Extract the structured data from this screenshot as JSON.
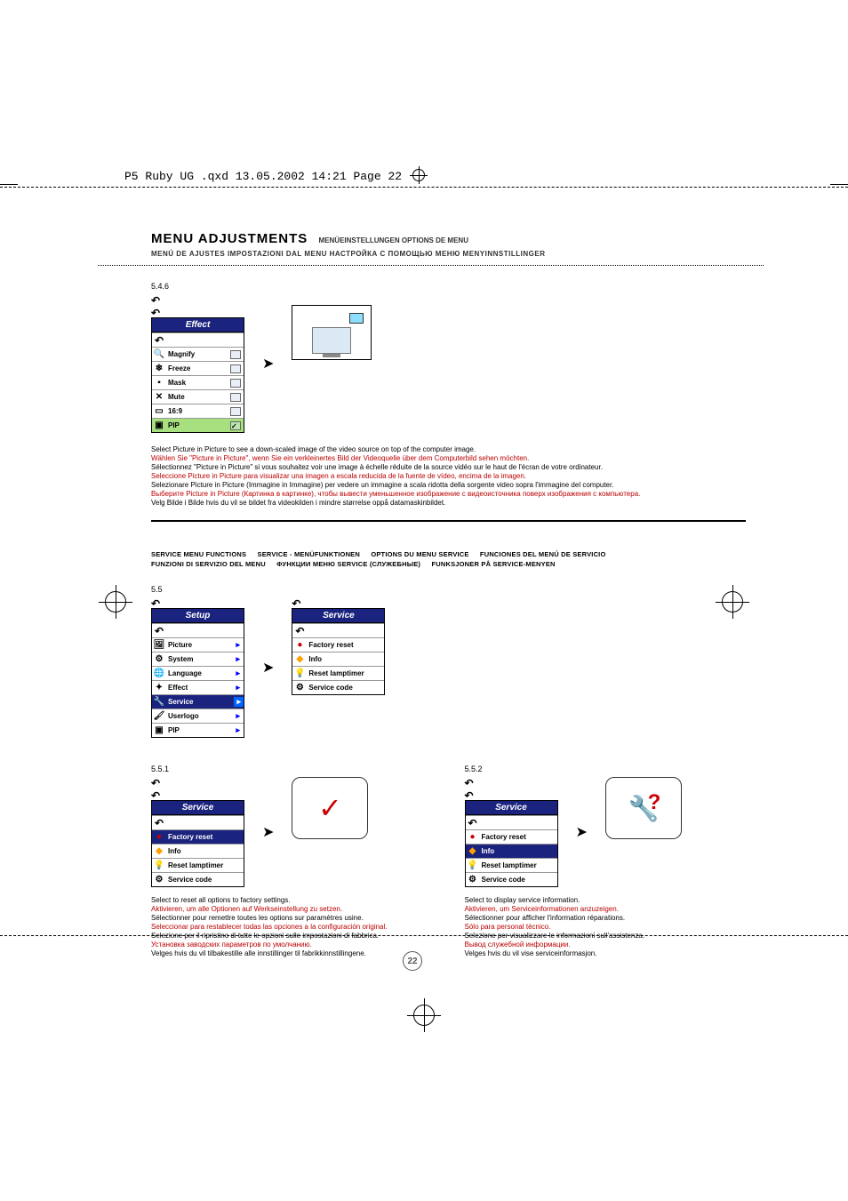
{
  "imposition_header": "P5 Ruby UG .qxd  13.05.2002  14:21  Page 22",
  "title": "MENU ADJUSTMENTS",
  "title_trans_line1": "MENÜEINSTELLUNGEN   OPTIONS DE MENU",
  "title_trans_line2": "MENÚ DE AJUSTES   IMPOSTAZIONI DAL MENU   НАСТРОЙКА С ПОМОЩЬЮ МЕНЮ   MENYINNSTILLINGER",
  "sec_546": "5.4.6",
  "effect_menu": {
    "title": "Effect",
    "items": [
      "Magnify",
      "Freeze",
      "Mask",
      "Mute",
      "16:9",
      "PIP"
    ]
  },
  "pip_desc": {
    "en": "Select Picture in Picture to see a down-scaled image of the video source on top of the computer image.",
    "de": "Wählen Sie \"Picture in Picture\", wenn Sie ein verkleinertes Bild der Videoquelle über dem Computerbild sehen möchten.",
    "fr": "Sélectionnez \"Picture in Picture\" si vous souhaitez voir une image à échelle réduite de la source vidéo sur le haut de l'écran de votre ordinateur.",
    "es": "Seleccione Picture in Picture para visualizar una imagen a escala reducida de la fuente de vídeo, encima de la imagen.",
    "it": "Selezionare Picture in Picture (Immagine in Immagine) per vedere un immagine a scala ridotta della sorgente video sopra l'immagine del computer.",
    "ru": "Выберите Picture in Picture (Картинка в картинке), чтобы вывести уменьшенное изображение с видеоисточника поверх изображения с компьютера.",
    "no": "Velg Bilde i Bilde hvis du vil se bildet fra videokilden i mindre størrelse oppå datamaskinbildet."
  },
  "service_heading": {
    "a": "SERVICE MENU FUNCTIONS",
    "b": "SERVICE - MENÜFUNKTIONEN",
    "c": "OPTIONS DU MENU SERVICE",
    "d": "FUNCIONES DEL MENÚ DE SERVICIO",
    "e": "FUNZIONI DI SERVIZIO DEL MENU",
    "f": "ФУНКЦИИ МЕНЮ SERVICE (СЛУЖЕБНЫЕ)",
    "g": "FUNKSJONER PÅ SERVICE-MENYEN"
  },
  "sec_55": "5.5",
  "setup_menu": {
    "title": "Setup",
    "items": [
      "Picture",
      "System",
      "Language",
      "Effect",
      "Service",
      "Userlogo",
      "PIP"
    ]
  },
  "service_menu": {
    "title": "Service",
    "items": [
      "Factory reset",
      "Info",
      "Reset lamptimer",
      "Service code"
    ]
  },
  "sec_551": "5.5.1",
  "sec_552": "5.5.2",
  "factory_reset_desc": {
    "en": "Select to reset all options to factory settings.",
    "de": "Aktivieren, um alle Optionen auf Werkseinstellung zu setzen.",
    "fr": "Sélectionner pour remettre toutes les options sur paramètres usine.",
    "es": "Seleccionar para restablecer todas las opciones a la configuración original.",
    "it": "Selezione per il ripristino di tutte le opzioni sulle impostazioni di fabbrica.",
    "ru": "Установка заводских параметров по умолчанию.",
    "no": "Velges hvis du vil tilbakestille alle innstillinger til fabrikkinnstillingene."
  },
  "info_desc": {
    "en": "Select to display service information.",
    "de": "Aktivieren, um Serviceinformationen anzuzeigen.",
    "fr": "Sélectionner pour afficher l'information réparations.",
    "es": "Sólo para personal técnico.",
    "it": "Selezione per visualizzare le informazioni sull'assistenza.",
    "ru": "Вывод служебной информации.",
    "no": "Velges hvis du vil vise serviceinformasjon."
  },
  "page_number": "22"
}
